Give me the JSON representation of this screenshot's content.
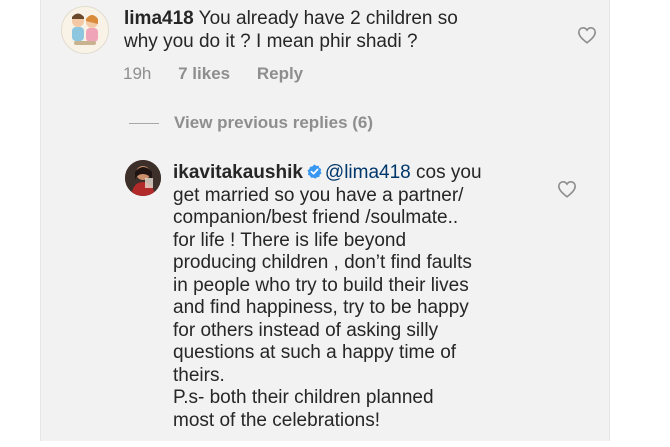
{
  "comment_1": {
    "username": "lima418",
    "text": " You already have 2 children so\nwhy you do it ? I mean phir shadi ?",
    "time": "19h",
    "likes": "7 likes",
    "reply_label": "Reply"
  },
  "view_replies": {
    "label": "View previous replies (6)"
  },
  "comment_2": {
    "username": "ikavitakaushik",
    "mention": "@lima418",
    "text_first": " cos you",
    "text": "get married so you have a partner/\ncompanion/best friend /soulmate..\nfor life ! There is life beyond\nproducing children , don’t find faults\nin people who try to build their lives\nand find happiness, try to be happy\nfor others instead of asking silly\nquestions at such a happy time of\ntheirs.",
    "ps": "P.s- both their children planned\nmost of the celebrations!"
  },
  "icons": {
    "like": "heart-outline-icon",
    "verified": "verified-badge-icon"
  },
  "colors": {
    "background": "#f2f2f2",
    "text": "#262626",
    "secondary_text": "#8e8e8e",
    "verified_blue": "#3897f0",
    "mention": "#00376b"
  }
}
